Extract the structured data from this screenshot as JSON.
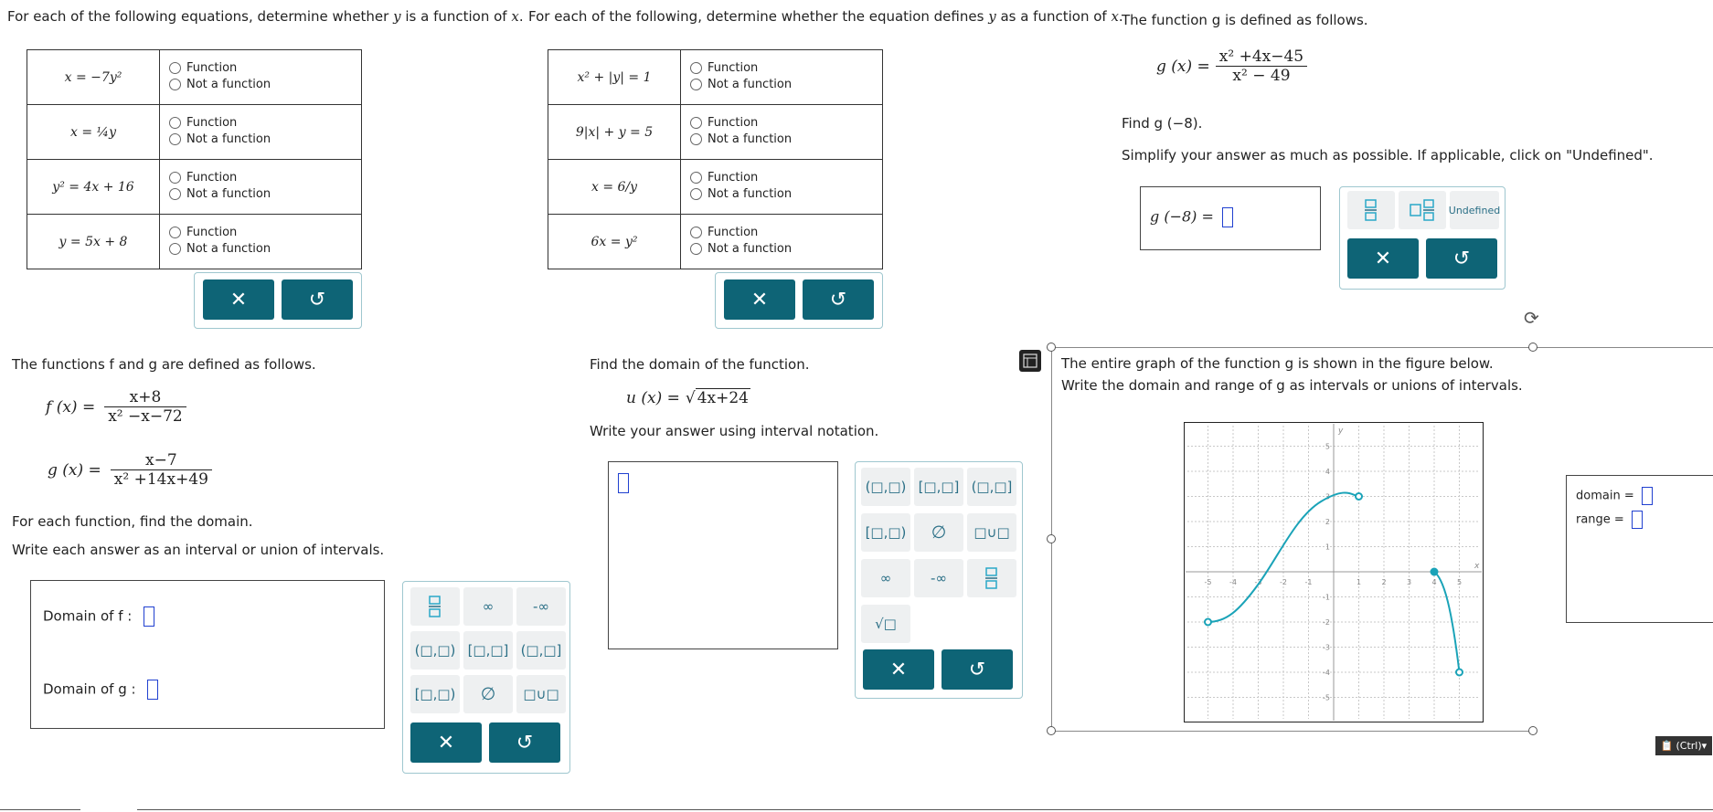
{
  "p1": {
    "instruction_pre": "For each of the following equations, determine whether ",
    "instruction_y": "y",
    "instruction_mid": " is a function of ",
    "instruction_x": "x",
    "instruction_end": ".",
    "rows": [
      {
        "eq": "x = −7y²"
      },
      {
        "eq": "x = ¼y"
      },
      {
        "eq": "y² = 4x + 16"
      },
      {
        "eq": "y = 5x + 8"
      }
    ],
    "opt_function": "Function",
    "opt_not_function": "Not a function"
  },
  "p2": {
    "instruction_pre": "For each of the following, determine whether the equation defines ",
    "instruction_y": "y",
    "instruction_mid": " as a function of ",
    "instruction_x": "x",
    "instruction_end": ".",
    "rows": [
      {
        "eq": "x² + |y| = 1"
      },
      {
        "eq": "9|x| + y = 5"
      },
      {
        "eq": "x = 6/y"
      },
      {
        "eq": "6x = y²"
      }
    ],
    "opt_function": "Function",
    "opt_not_function": "Not a function"
  },
  "p3": {
    "intro": "The function g is defined as follows.",
    "g_lhs": "g (x) =",
    "g_num": "x² +4x−45",
    "g_den": "x² − 49",
    "find": "Find g (−8).",
    "simplify": "Simplify your answer as much as possible. If applicable, click on \"Undefined\".",
    "answer_lhs": "g (−8)  =",
    "undefined_label": "Undefined"
  },
  "p4": {
    "intro": "The functions f and g are defined as follows.",
    "f_lhs": "f (x)  =",
    "f_num": "x+8",
    "f_den": "x² −x−72",
    "g_lhs": "g (x)  =",
    "g_num": "x−7",
    "g_den": "x² +14x+49",
    "each": "For each function, find the domain.",
    "write": "Write each answer as an interval or union of intervals.",
    "domain_f": "Domain of f :",
    "domain_g": "Domain of g :"
  },
  "p5": {
    "find": "Find the domain of the function.",
    "u_lhs": "u (x) =",
    "u_rad": "4x+24",
    "write": "Write your answer using interval notation."
  },
  "p6": {
    "line1": "The entire graph of the function g is shown in the figure below.",
    "line2": "Write the domain and range of g as intervals or unions of intervals.",
    "domain_label": "domain  =",
    "range_label": "range  =",
    "x_axis": "x",
    "y_axis": "y",
    "x_ticks": [
      "-5",
      "-4",
      "-3",
      "-2",
      "-1",
      "1",
      "2",
      "3",
      "4",
      "5"
    ],
    "y_ticks": [
      "5",
      "4",
      "3",
      "2",
      "1",
      "-1",
      "-2",
      "-3",
      "-4",
      "-5"
    ]
  },
  "keys": {
    "interval_oo": "(□,□)",
    "interval_cc": "[□,□]",
    "interval_oc": "(□,□]",
    "interval_co": "[□,□)",
    "empty": "∅",
    "union": "□∪□",
    "inf": "∞",
    "neg_inf": "-∞",
    "sqrt": "√□",
    "clear": "✕",
    "undo": "↺"
  },
  "paste": {
    "label": "(Ctrl)"
  },
  "colors": {
    "teal": "#0e6476",
    "graph": "#1aa3b8",
    "cursor": "#2040d0"
  }
}
